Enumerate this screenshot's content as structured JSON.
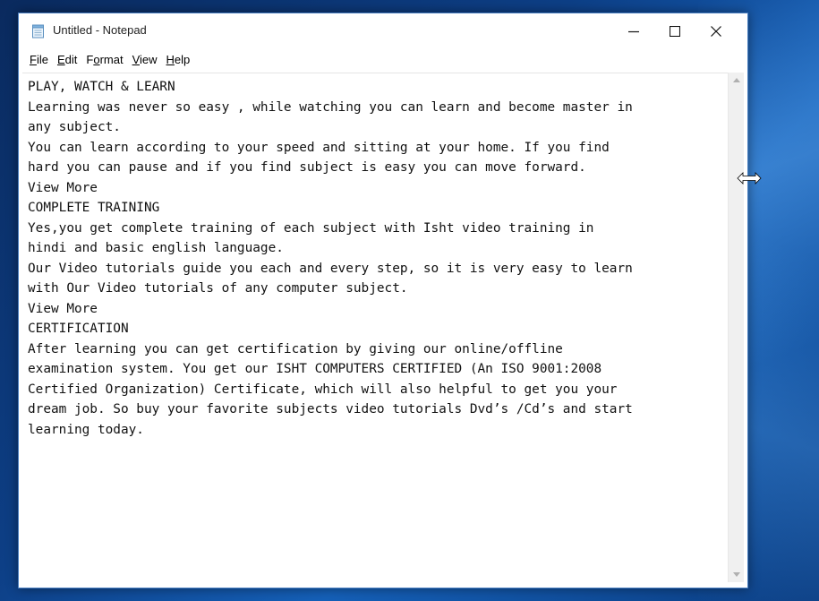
{
  "window": {
    "title": "Untitled - Notepad"
  },
  "menu": [
    {
      "id": "file",
      "accel": "F",
      "rest": "ile"
    },
    {
      "id": "edit",
      "accel": "E",
      "rest": "dit"
    },
    {
      "id": "format",
      "pre": "F",
      "accel": "o",
      "rest": "rmat"
    },
    {
      "id": "view",
      "accel": "V",
      "rest": "iew"
    },
    {
      "id": "help",
      "accel": "H",
      "rest": "elp"
    }
  ],
  "editor": {
    "lines": [
      "PLAY, WATCH & LEARN",
      "Learning was never so easy , while watching you can learn and become master in",
      "any subject.",
      "You can learn according to your speed and sitting at your home. If you find",
      "hard you can pause and if you find subject is easy you can move forward.",
      "View More",
      "COMPLETE TRAINING",
      "Yes,you get complete training of each subject with Isht video training in",
      "hindi and basic english language.",
      "Our Video tutorials guide you each and every step, so it is very easy to learn",
      "with Our Video tutorials of any computer subject.",
      "View More",
      "CERTIFICATION",
      "After learning you can get certification by giving our online/offline",
      "examination system. You get our ISHT COMPUTERS CERTIFIED (An ISO 9001:2008",
      "Certified Organization) Certificate, which will also helpful to get you your",
      "dream job. So buy your favorite subjects video tutorials Dvd’s /Cd’s and start",
      "learning today."
    ]
  },
  "icons": {
    "app": "notepad-icon",
    "minimize": "minimize-icon",
    "maximize": "maximize-icon",
    "close": "close-icon",
    "cursor": "resize-horizontal-cursor-icon"
  }
}
